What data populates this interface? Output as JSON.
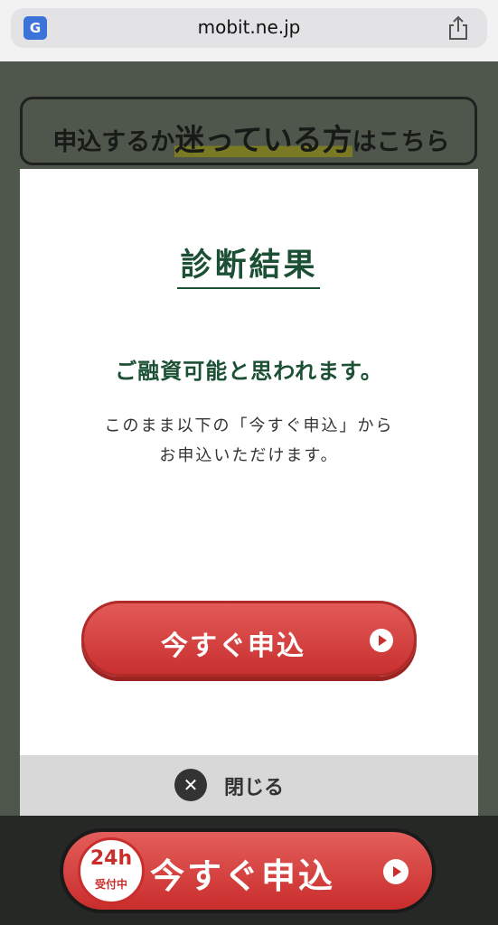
{
  "browser": {
    "url": "mobit.ne.jp",
    "translate_icon": "translate-icon",
    "share_icon": "share-icon"
  },
  "page": {
    "callout_prefix": "申込するか",
    "callout_emphasis": "迷っている方",
    "callout_suffix": "はこちら"
  },
  "modal": {
    "title": "診断結果",
    "headline": "ご融資可能と思われます。",
    "description_line1": "このまま以下の「今すぐ申込」から",
    "description_line2": "お申込いただけます。",
    "apply_label": "今すぐ申込",
    "close_label": "閉じる",
    "close_icon": "close-icon"
  },
  "bottom_bar": {
    "badge_top": "24h",
    "badge_bottom": "受付中",
    "apply_label": "今すぐ申込"
  },
  "colors": {
    "accent_green": "#1c5035",
    "button_red": "#c8302f"
  }
}
